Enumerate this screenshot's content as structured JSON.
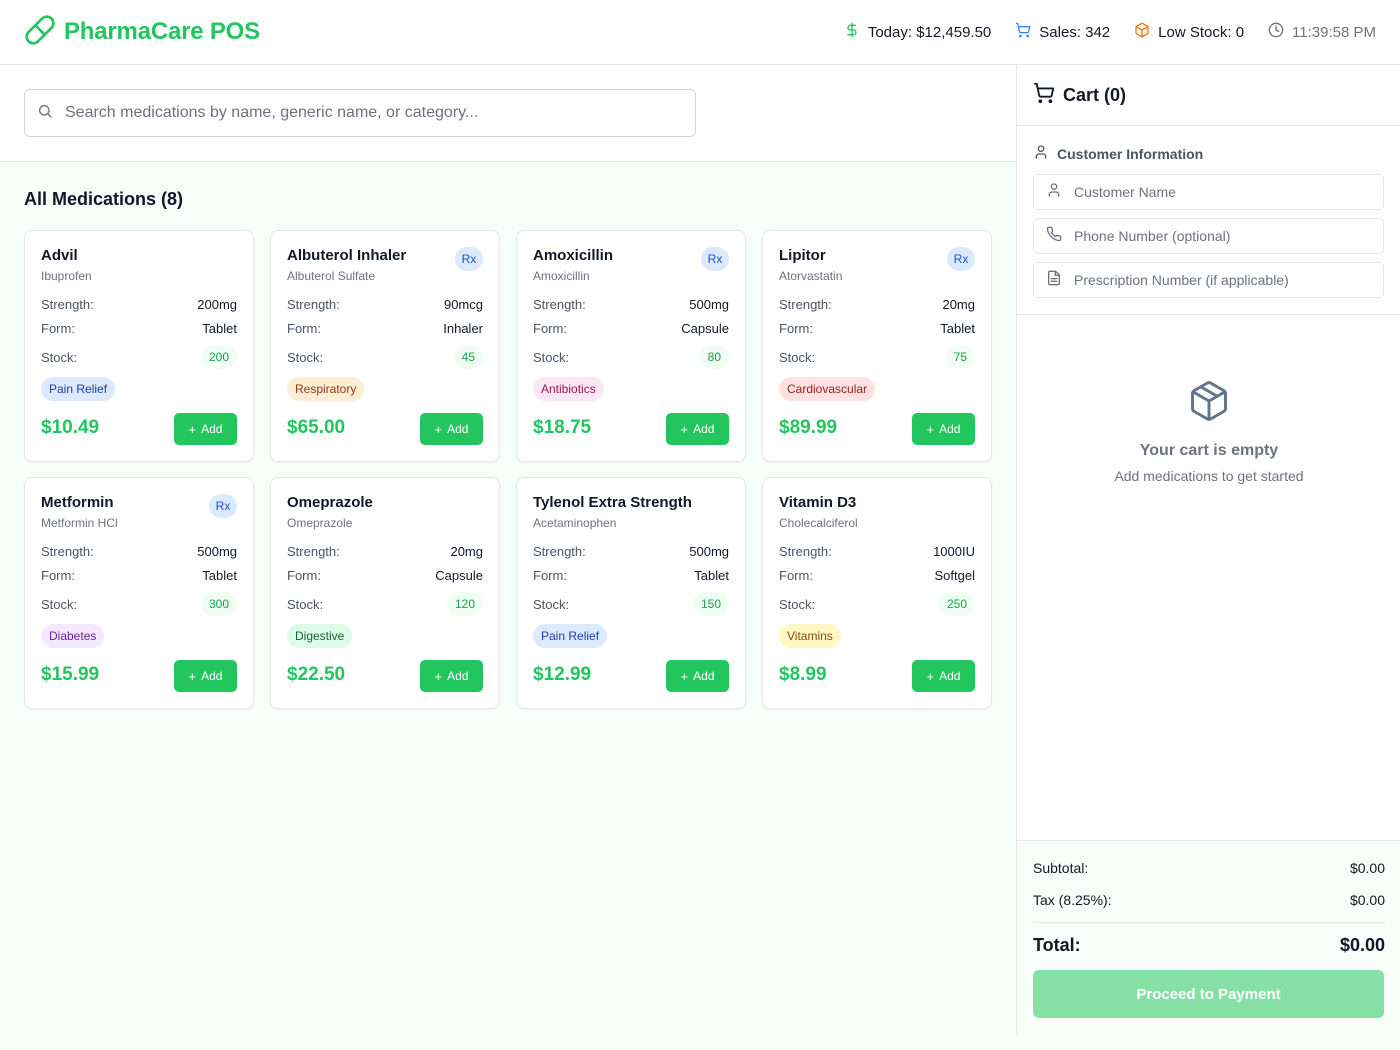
{
  "header": {
    "brand": "PharmaCare POS",
    "today": "Today: $12,459.50",
    "sales": "Sales: 342",
    "low_stock": "Low Stock: 0",
    "time": "11:39:58 PM"
  },
  "search": {
    "placeholder": "Search medications by name, generic name, or category..."
  },
  "section_title": "All Medications (8)",
  "labels": {
    "strength": "Strength:",
    "form": "Form:",
    "stock": "Stock:",
    "rx": "Rx",
    "add": "Add"
  },
  "medications": [
    {
      "name": "Advil",
      "generic": "Ibuprofen",
      "strength": "200mg",
      "form": "Tablet",
      "stock": "200",
      "category": "Pain Relief",
      "price": "$10.49",
      "rx": false
    },
    {
      "name": "Albuterol Inhaler",
      "generic": "Albuterol Sulfate",
      "strength": "90mcg",
      "form": "Inhaler",
      "stock": "45",
      "category": "Respiratory",
      "price": "$65.00",
      "rx": true
    },
    {
      "name": "Amoxicillin",
      "generic": "Amoxicillin",
      "strength": "500mg",
      "form": "Capsule",
      "stock": "80",
      "category": "Antibiotics",
      "price": "$18.75",
      "rx": true
    },
    {
      "name": "Lipitor",
      "generic": "Atorvastatin",
      "strength": "20mg",
      "form": "Tablet",
      "stock": "75",
      "category": "Cardiovascular",
      "price": "$89.99",
      "rx": true
    },
    {
      "name": "Metformin",
      "generic": "Metformin HCl",
      "strength": "500mg",
      "form": "Tablet",
      "stock": "300",
      "category": "Diabetes",
      "price": "$15.99",
      "rx": true
    },
    {
      "name": "Omeprazole",
      "generic": "Omeprazole",
      "strength": "20mg",
      "form": "Capsule",
      "stock": "120",
      "category": "Digestive",
      "price": "$22.50",
      "rx": false
    },
    {
      "name": "Tylenol Extra Strength",
      "generic": "Acetaminophen",
      "strength": "500mg",
      "form": "Tablet",
      "stock": "150",
      "category": "Pain Relief",
      "price": "$12.99",
      "rx": false
    },
    {
      "name": "Vitamin D3",
      "generic": "Cholecalciferol",
      "strength": "1000IU",
      "form": "Softgel",
      "stock": "250",
      "category": "Vitamins",
      "price": "$8.99",
      "rx": false
    }
  ],
  "category_colors": {
    "Pain Relief": {
      "bg": "#dbeafe",
      "fg": "#1e40af"
    },
    "Respiratory": {
      "bg": "#ffedd5",
      "fg": "#9a3412"
    },
    "Antibiotics": {
      "bg": "#fce7f3",
      "fg": "#9d174d"
    },
    "Cardiovascular": {
      "bg": "#fee2e2",
      "fg": "#991b1b"
    },
    "Diabetes": {
      "bg": "#f3e8ff",
      "fg": "#6b21a8"
    },
    "Digestive": {
      "bg": "#dcfce7",
      "fg": "#166534"
    },
    "Vitamins": {
      "bg": "#fef9c3",
      "fg": "#854d0e"
    }
  },
  "cart": {
    "title": "Cart (0)",
    "customer_title": "Customer Information",
    "name_placeholder": "Customer Name",
    "phone_placeholder": "Phone Number (optional)",
    "rx_placeholder": "Prescription Number (if applicable)",
    "empty_title": "Your cart is empty",
    "empty_sub": "Add medications to get started",
    "subtotal_label": "Subtotal:",
    "subtotal": "$0.00",
    "tax_label": "Tax (8.25%):",
    "tax": "$0.00",
    "total_label": "Total:",
    "total": "$0.00",
    "pay_label": "Proceed to Payment"
  },
  "colors": {
    "accent": "#22c55e",
    "pay_disabled": "#86e0a6"
  }
}
